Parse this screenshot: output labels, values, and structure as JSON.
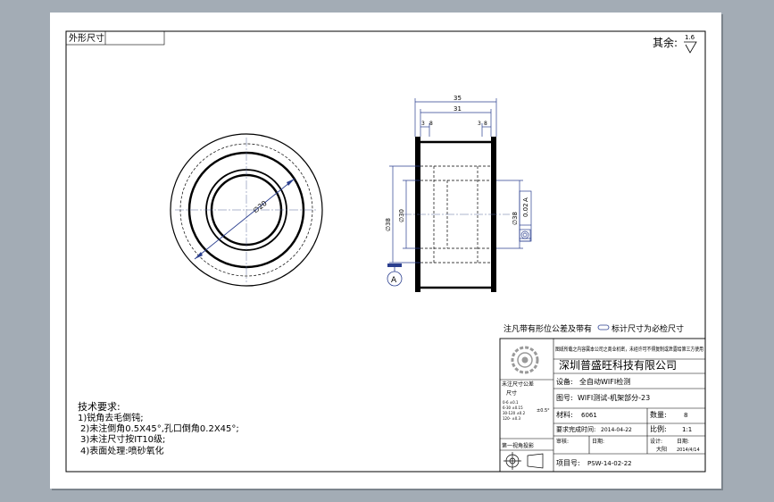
{
  "corner_label": "外形尺寸",
  "roughness": {
    "label": "其余:",
    "value": "1.6"
  },
  "dimensions": {
    "overall_length": "35",
    "inner_length": "31",
    "flange_left": "3",
    "chamfer_left": "8",
    "flange_right": "3",
    "chamfer_right": "8",
    "front_dia": "∅20",
    "dia_outer": "∅38",
    "dia_bore": "∅30",
    "dia_right": "∅38"
  },
  "datum_letter": "A",
  "tolerance_frame": {
    "value": "0.02",
    "datum": "A"
  },
  "notes_line": {
    "part1": "注凡带有形位公差及带有",
    "part2": "标计尺寸为必检尺寸"
  },
  "tech": {
    "heading": "技术要求:",
    "items": [
      "1)锐角去毛倒钝;",
      "2)未注倒角0.5X45°,孔口倒角0.2X45°;",
      "3)未注尺寸按IT10级;",
      "4)表面处理:喷砂氧化"
    ]
  },
  "title_block": {
    "header_text": "图纸所载之内容属本公司之商业机密，未经许可不得复制或泄露给第三方使用",
    "company": "深圳普盛旺科技有限公司",
    "device_label": "设备:",
    "device": "全自动WIFI检测",
    "drawing_no_label": "图号:",
    "drawing_no": "WIFI测试-机架部分-23",
    "material_label": "材料:",
    "material": "6061",
    "qty_label": "数量:",
    "qty": "8",
    "due_label": "要求完成时间:",
    "due": "2014-04-22",
    "scale_label": "比例:",
    "scale": "1:1",
    "check_label": "审核:",
    "check_date_label": "日期:",
    "design_label": "设计:",
    "designer": "大阳",
    "design_date_label": "日期:",
    "design_date": "2014/4/14",
    "view_label": "第一视角投影",
    "project_label": "项目号:",
    "project": "PSW-14-02-22",
    "tol_title": "未注尺寸公差",
    "tol_sub": "尺寸",
    "tol_rows": [
      "0-6 ±0.1",
      "6-30 ±0.15",
      "30-120 ±0.2",
      "120- ±0.3"
    ],
    "angle_tol": "±0.5°"
  }
}
